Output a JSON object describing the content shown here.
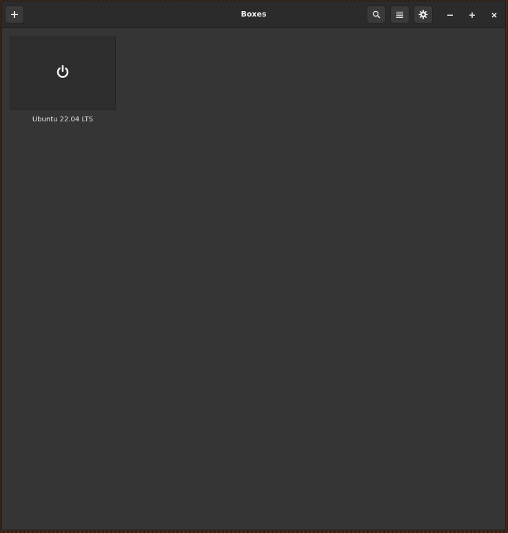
{
  "window": {
    "title": "Boxes"
  },
  "headerbar": {
    "new_button_icon": "plus-icon",
    "search_button_icon": "search-icon",
    "select_button_icon": "list-icon",
    "preferences_button_icon": "gear-icon",
    "window_controls": [
      "minimize-icon",
      "maximize-icon",
      "close-icon"
    ]
  },
  "boxes": [
    {
      "name": "Ubuntu 22.04 LTS",
      "thumbnail_icon": "power-icon"
    }
  ],
  "colors": {
    "window_bg": "#353535",
    "headerbar_bg": "#2b2b2b",
    "thumbnail_bg": "#2d2d2d",
    "text": "#e8e8e8"
  }
}
